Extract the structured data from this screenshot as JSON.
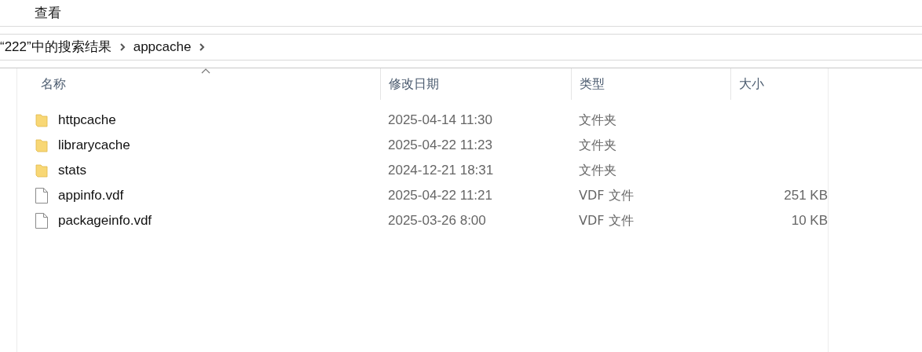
{
  "menu": [
    {
      "label": "查看"
    }
  ],
  "address": {
    "segments": [
      "“222”中的搜索结果",
      "appcache"
    ]
  },
  "table": {
    "columns": [
      {
        "label": "名称",
        "sorted": true
      },
      {
        "label": "修改日期",
        "sorted": false
      },
      {
        "label": "类型",
        "sorted": false
      },
      {
        "label": "大小",
        "sorted": false
      }
    ],
    "rows": [
      {
        "kind": "folder",
        "name": "httpcache",
        "date": "2025-04-14 11:30",
        "type": "文件夹"
      },
      {
        "kind": "folder",
        "name": "librarycache",
        "date": "2025-04-22 11:23",
        "type": "文件夹"
      },
      {
        "kind": "folder",
        "name": "stats",
        "date": "2024-12-21 18:31",
        "type": "文件夹"
      },
      {
        "kind": "file",
        "name": "appinfo.vdf",
        "date": "2025-04-22 11:21",
        "type": "VDF 文件",
        "size": "251 KB"
      },
      {
        "kind": "file",
        "name": "packageinfo.vdf",
        "date": "2025-03-26 8:00",
        "type": "VDF 文件",
        "size": "10 KB"
      }
    ]
  }
}
